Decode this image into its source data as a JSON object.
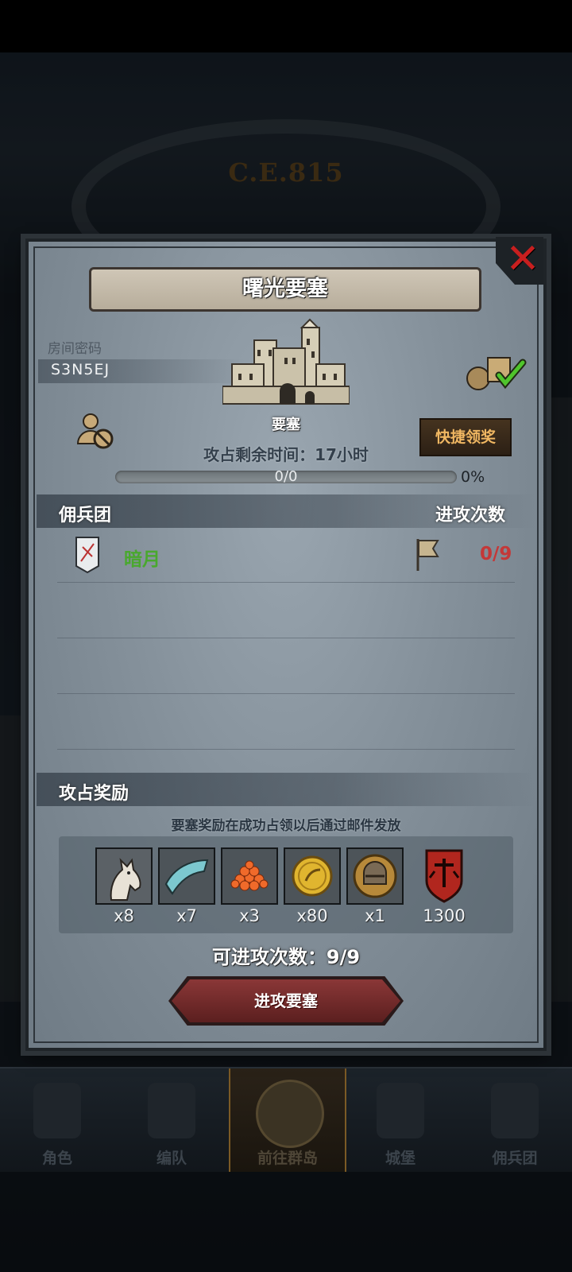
{
  "background": {
    "era_text": "C.E.815"
  },
  "dialog": {
    "title": "曙光要塞",
    "room": {
      "label": "房间密码",
      "code": "S3N5EJ"
    },
    "building": {
      "label": "要塞",
      "icon": "castle-icon"
    },
    "remaining_time": "攻占剩余时间：17小时",
    "quick_claim_label": "快捷领奖",
    "progress": {
      "text": "0/0",
      "percent_text": "0%",
      "value": 0
    },
    "mercenary_section": {
      "title": "佣兵团",
      "attack_count_title": "进攻次数",
      "rows": [
        {
          "name": "暗月",
          "attacks": "0/9"
        }
      ]
    },
    "reward_section": {
      "title": "攻占奖励",
      "note": "要塞奖励在成功占领以后通过邮件发放",
      "items": [
        {
          "icon": "horse-icon",
          "qty": "x8"
        },
        {
          "icon": "cloth-icon",
          "qty": "x7"
        },
        {
          "icon": "beads-icon",
          "qty": "x3"
        },
        {
          "icon": "gold-coin-icon",
          "qty": "x80"
        },
        {
          "icon": "helmet-coin-icon",
          "qty": "x1"
        },
        {
          "icon": "guild-emblem-icon",
          "qty": "1300"
        }
      ]
    },
    "attempts_left": "可进攻次数：9/9",
    "attack_button_label": "进攻要塞"
  },
  "bottom_nav": {
    "items": [
      {
        "label": "角色"
      },
      {
        "label": "编队"
      },
      {
        "label": "前往群岛"
      },
      {
        "label": "城堡"
      },
      {
        "label": "佣兵团"
      }
    ],
    "active_index": 2
  },
  "colors": {
    "accent_gold": "#f0b762",
    "mercenary_green": "#49a82e",
    "attack_red": "#c43838",
    "close_red": "#c81f1f"
  }
}
